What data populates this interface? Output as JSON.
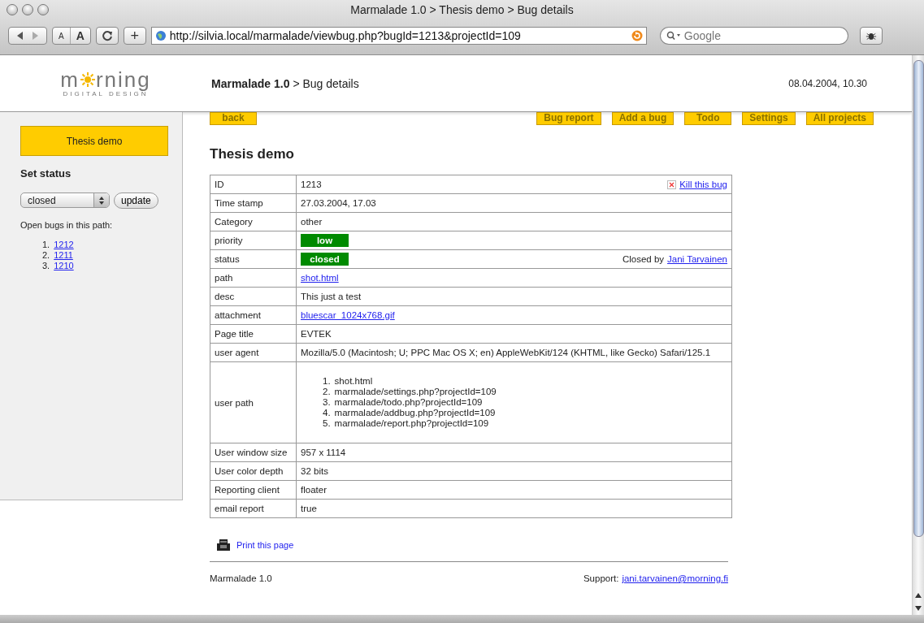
{
  "window": {
    "title": "Marmalade 1.0 > Thesis demo > Bug details"
  },
  "toolbar": {
    "text_small": "A",
    "text_large": "A",
    "add": "+",
    "url": "http://silvia.local/marmalade/viewbug.php?bugId=1213&projectId=109",
    "search": {
      "placeholder": "Google"
    }
  },
  "header": {
    "logo": {
      "left": "m",
      "right": "rning",
      "tagline": "DIGITAL DESIGN"
    },
    "title": "**Marmalade 1.0** > Bug details",
    "date": "08.04.2004, 10.30"
  },
  "sidebar": {
    "project": "Thesis demo",
    "status_heading": "Set status",
    "status_select": "closed",
    "update_button": "update",
    "open_bugs_label": "Open bugs in this path:",
    "open_bugs": [
      {
        "number": "1.",
        "id": "1212"
      },
      {
        "number": "2.",
        "id": "1211"
      },
      {
        "number": "3.",
        "id": "1210"
      }
    ]
  },
  "nav": {
    "left": [
      "back"
    ],
    "right": [
      "Bug report",
      "Add a bug",
      "Todo",
      "Settings",
      "All projects"
    ]
  },
  "page_title": "Thesis demo",
  "rows": [
    {
      "label": "ID",
      "kind": "text",
      "value": "1213",
      "extra": {
        "kind": "kill",
        "link": "Kill this bug"
      }
    },
    {
      "label": "Time stamp",
      "kind": "text",
      "value": "27.03.2004, 17.03"
    },
    {
      "label": "Category",
      "kind": "text",
      "value": "other"
    },
    {
      "label": "priority",
      "kind": "badge",
      "value": "low"
    },
    {
      "label": "status",
      "kind": "badge",
      "value": "closed",
      "extra": {
        "kind": "closed_by",
        "text": "Closed by",
        "link": "Jani Tarvainen"
      }
    },
    {
      "label": "path",
      "kind": "link",
      "value": "shot.html"
    },
    {
      "label": "desc",
      "kind": "text",
      "value": "This just a test"
    },
    {
      "label": "attachment",
      "kind": "link",
      "value": "bluescar_1024x768.gif"
    },
    {
      "label": "Page title",
      "kind": "text",
      "value": "EVTEK"
    },
    {
      "label": "user agent",
      "kind": "text",
      "value": "Mozilla/5.0 (Macintosh; U; PPC Mac OS X; en) AppleWebKit/124 (KHTML, like Gecko) Safari/125.1"
    },
    {
      "label": "user path",
      "kind": "list",
      "items": [
        {
          "number": "1.",
          "text": "shot.html"
        },
        {
          "number": "2.",
          "text": "marmalade/settings.php?projectId=109"
        },
        {
          "number": "3.",
          "text": "marmalade/todo.php?projectId=109"
        },
        {
          "number": "4.",
          "text": "marmalade/addbug.php?projectId=109"
        },
        {
          "number": "5.",
          "text": "marmalade/report.php?projectId=109"
        }
      ]
    },
    {
      "label": "User window size",
      "kind": "text",
      "value": "957 x 1114"
    },
    {
      "label": "User color depth",
      "kind": "text",
      "value": "32 bits"
    },
    {
      "label": "Reporting client",
      "kind": "text",
      "value": "floater"
    },
    {
      "label": "email report",
      "kind": "text",
      "value": "true"
    }
  ],
  "print_link": "Print this page",
  "footer": {
    "left": "Marmalade 1.0",
    "support_label": "Support:",
    "support_link": "jani.tarvainen@morning.fi"
  }
}
